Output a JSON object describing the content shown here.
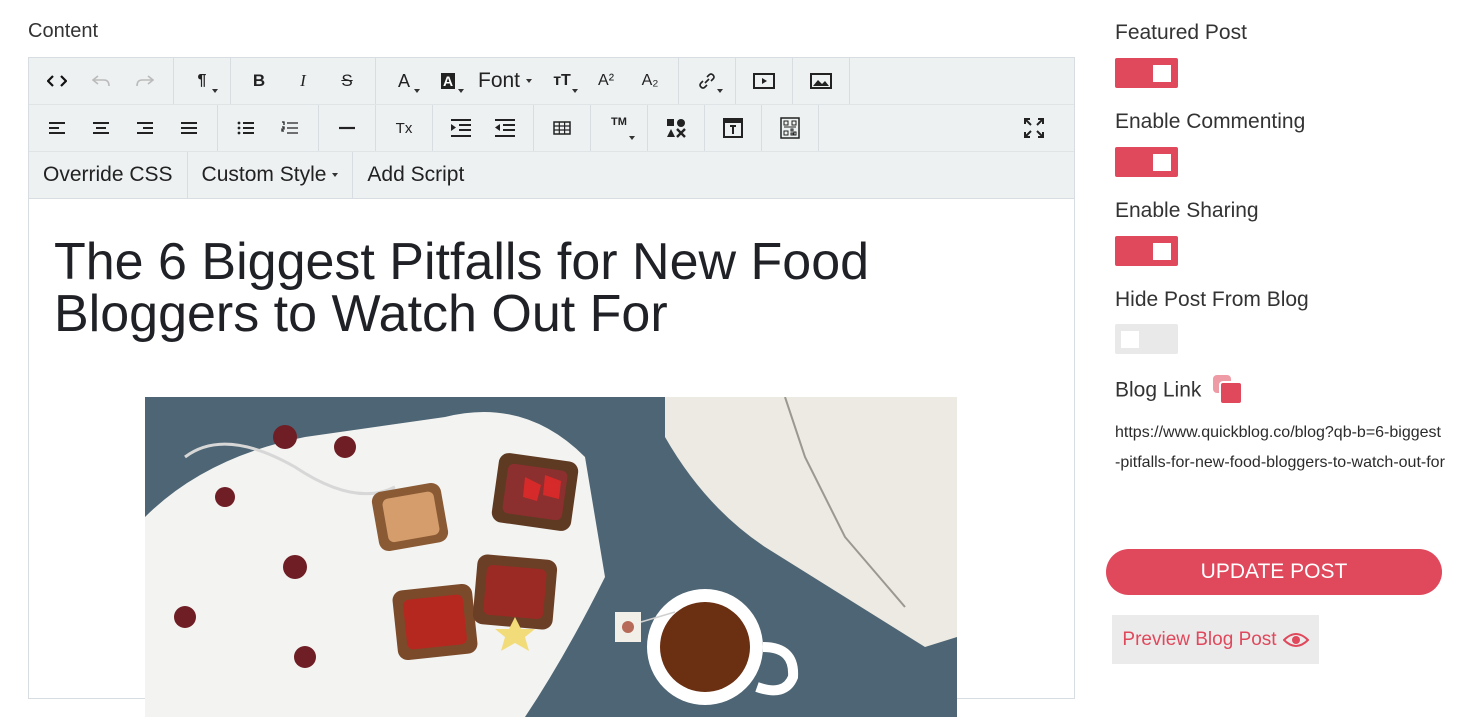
{
  "content_label": "Content",
  "toolbar": {
    "paragraph_glyph": "¶",
    "bold": "B",
    "italic": "I",
    "strike": "S",
    "font_color": "A",
    "highlight": "A",
    "font": "Font",
    "font_size_glyph": "тT",
    "superscript": "A²",
    "subscript": "A₂",
    "clear_format": "Tx",
    "trademark": "TM",
    "override_css": "Override CSS",
    "custom_style": "Custom Style",
    "add_script": "Add Script"
  },
  "document": {
    "title": "The 6 Biggest Pitfalls for New Food Bloggers to Watch Out For"
  },
  "settings": {
    "featured_post": {
      "label": "Featured Post",
      "on": true
    },
    "enable_commenting": {
      "label": "Enable Commenting",
      "on": true
    },
    "enable_sharing": {
      "label": "Enable Sharing",
      "on": true
    },
    "hide_post": {
      "label": "Hide Post From Blog",
      "on": false
    },
    "blog_link_label": "Blog Link",
    "blog_url": "https://www.quickblog.co/blog?qb-b=6-biggest-pitfalls-for-new-food-bloggers-to-watch-out-for"
  },
  "actions": {
    "update": "UPDATE POST",
    "preview": "Preview Blog Post"
  },
  "colors": {
    "accent": "#e0485c",
    "toolbar_bg": "#edf1f2",
    "toggle_off": "#e9e9e9"
  }
}
